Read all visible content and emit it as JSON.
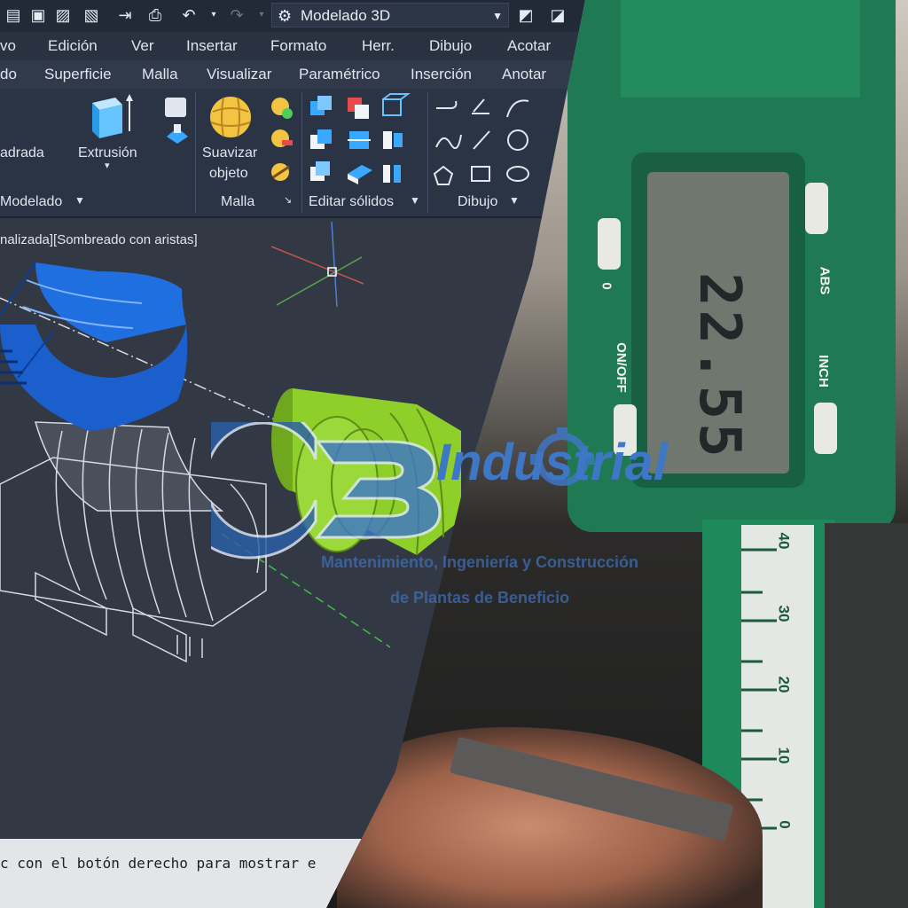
{
  "app": {
    "workspace": "Modelado 3D",
    "menu": [
      "vo",
      "Edición",
      "Ver",
      "Insertar",
      "Formato",
      "Herr.",
      "Dibujo",
      "Acotar"
    ],
    "tabs": [
      "do",
      "Superficie",
      "Malla",
      "Visualizar",
      "Paramétrico",
      "Inserción",
      "Anotar"
    ],
    "ribbon": {
      "tools": {
        "cuadrada": "adrada",
        "extrusion": "Extrusión",
        "suavizar_1": "Suavizar",
        "suavizar_2": "objeto"
      },
      "panels": {
        "modelado": "Modelado",
        "malla": "Malla",
        "editar_solidos": "Editar sólidos",
        "dibujo": "Dibujo"
      }
    },
    "viewport_label": "nalizada][Sombreado con aristas]",
    "command_line": "c con el botón derecho para mostrar e"
  },
  "caliper": {
    "reading": "22.55",
    "buttons": {
      "zero": "0",
      "on_off": "ON/OFF",
      "abs": "ABS",
      "inch": "INCH"
    },
    "scale": [
      "40",
      "30",
      "20",
      "10",
      "0"
    ]
  },
  "watermark": {
    "name": "Industrial",
    "tagline_1": "Mantenimiento, Ingeniería y Construcción",
    "tagline_2": "de Plantas de Beneficio"
  },
  "colors": {
    "ribbon": "#2b3444",
    "viewport": "#333944",
    "bushing_blue": "#1f6fe0",
    "part_green": "#8fcf2a",
    "caliper_green": "#1f7a54",
    "logo_blue": "#3e77c6"
  }
}
